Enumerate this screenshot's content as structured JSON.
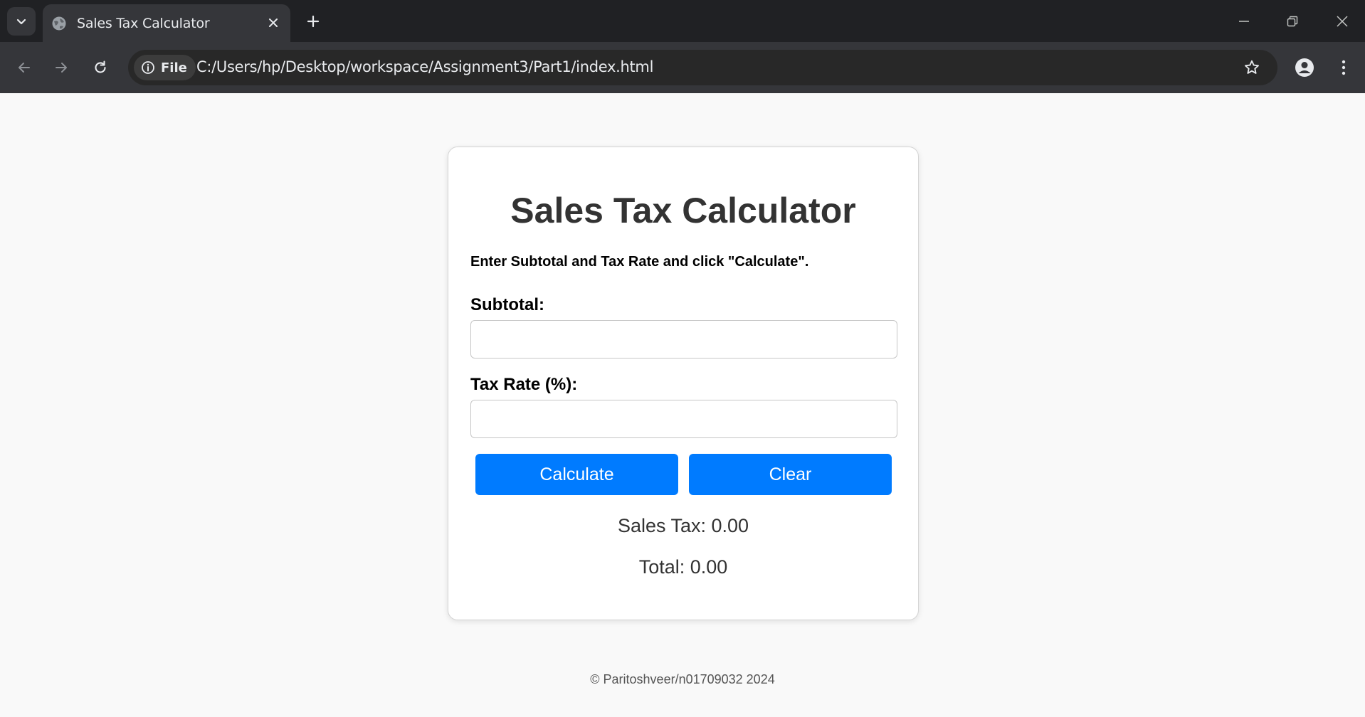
{
  "browser": {
    "tab": {
      "title": "Sales Tax Calculator",
      "favicon": "globe-icon"
    },
    "omnibox": {
      "chip_label": "File",
      "url": "C:/Users/hp/Desktop/workspace/Assignment3/Part1/index.html"
    }
  },
  "card": {
    "title": "Sales Tax Calculator",
    "instructions": "Enter Subtotal and Tax Rate and click \"Calculate\".",
    "subtotal": {
      "label": "Subtotal:",
      "value": ""
    },
    "tax_rate": {
      "label": "Tax Rate (%):",
      "value": ""
    },
    "buttons": {
      "calculate": "Calculate",
      "clear": "Clear"
    },
    "results": {
      "sales_tax": "Sales Tax: 0.00",
      "total": "Total: 0.00"
    }
  },
  "footer": {
    "text": "© Paritoshveer/n01709032 2024"
  },
  "colors": {
    "accent": "#007bff",
    "chrome_dark": "#202124",
    "chrome_toolbar": "#35363a",
    "page_bg": "#f9f9f9"
  }
}
